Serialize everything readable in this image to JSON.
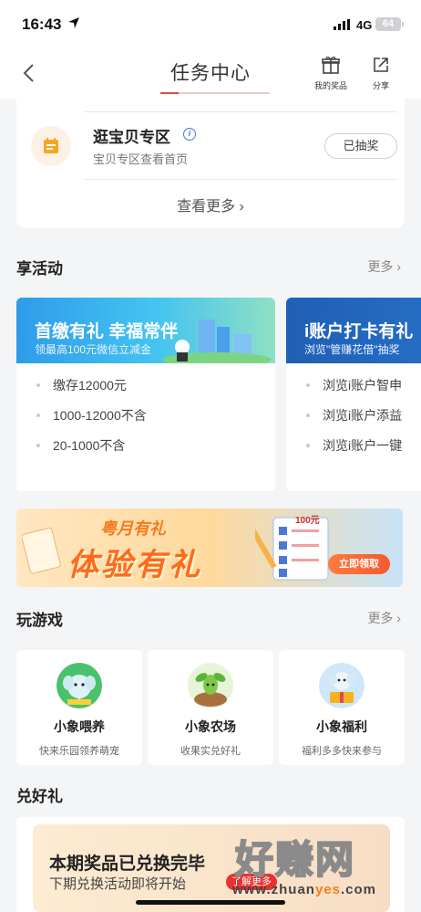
{
  "status": {
    "time": "16:43",
    "network": "4G",
    "battery": "64"
  },
  "nav": {
    "title": "任务中心",
    "prizes_label": "我的奖品",
    "share_label": "分享"
  },
  "task": {
    "title": "逛宝贝专区",
    "subtitle": "宝贝专区查看首页",
    "status_label": "已抽奖",
    "more_label": "查看更多 ›"
  },
  "activities": {
    "header": "享活动",
    "more": "更多 ›",
    "cards": [
      {
        "title": "首缴有礼 幸福常伴",
        "subtitle": "领最高100元微信立减金",
        "items": [
          "缴存12000元",
          "1000-12000不含",
          "20-1000不含"
        ]
      },
      {
        "title": "i账户打卡有礼",
        "subtitle": "浏览\"管赚花借\"抽奖",
        "items": [
          "浏览i账户智申",
          "浏览i账户添益",
          "浏览i账户一键"
        ]
      }
    ]
  },
  "promo": {
    "line1": "粤月有礼",
    "line2": "体验有礼",
    "badge": "100元",
    "button": "立即领取"
  },
  "games": {
    "header": "玩游戏",
    "more": "更多 ›",
    "items": [
      {
        "name": "小象喂养",
        "desc": "快来乐园领养萌宠",
        "icon": "elephant-icon"
      },
      {
        "name": "小象农场",
        "desc": "收果实兑好礼",
        "icon": "sprout-icon"
      },
      {
        "name": "小象福利",
        "desc": "福利多多快来参与",
        "icon": "gift-elephant-icon"
      }
    ]
  },
  "redeem": {
    "header": "兑好礼",
    "title": "本期奖品已兑换完毕",
    "subtitle": "下期兑换活动即将开始",
    "tag": "了解更多"
  },
  "watermark": {
    "text": "好赚网",
    "url_prefix": "www.zhuan",
    "url_highlight": "yes",
    "url_suffix": ".com"
  },
  "colors": {
    "accent": "#e04b4b",
    "brand_blue": "#1f5fb4",
    "orange": "#f47b20"
  }
}
